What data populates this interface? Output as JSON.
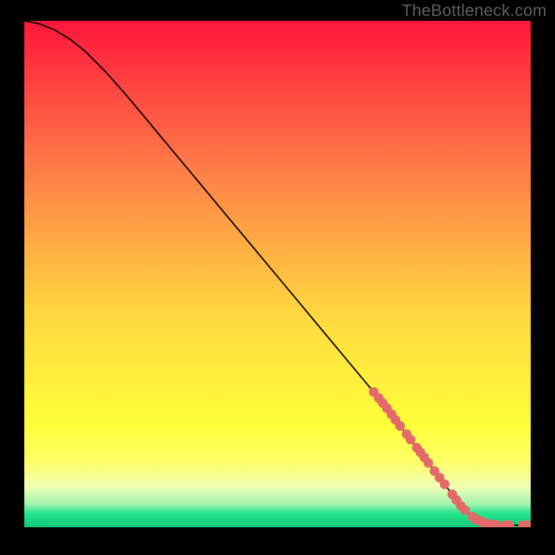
{
  "watermark": "TheBottleneck.com",
  "colors": {
    "frame": "#000000",
    "watermark": "#5f5f5f",
    "curve": "#000000",
    "marker": "#e46a6a",
    "gradient_top": "#ff163b",
    "gradient_mid1": "#ff7948",
    "gradient_mid2": "#ffd83f",
    "gradient_band_top": "#ffff67",
    "gradient_band_bot": "#f1ffb3",
    "gradient_green": "#27e58e",
    "gradient_bottom": "#0fc877"
  },
  "chart_data": {
    "type": "line",
    "title": "",
    "xlabel": "",
    "ylabel": "",
    "xlim": [
      0,
      100
    ],
    "ylim": [
      0,
      100
    ],
    "series": [
      {
        "name": "bottleneck-curve",
        "x": [
          0,
          3,
          6,
          9,
          12,
          16,
          20,
          25,
          30,
          35,
          40,
          45,
          50,
          55,
          60,
          65,
          70,
          75,
          80,
          83,
          85,
          87,
          88.5,
          90,
          92,
          95,
          100
        ],
        "y": [
          100,
          99.4,
          98.2,
          96.4,
          94,
          90,
          85.5,
          79.5,
          73.5,
          67.5,
          61.5,
          55.5,
          49.5,
          43.5,
          37.5,
          31.5,
          25.5,
          19,
          12.5,
          8.5,
          5.8,
          3.4,
          2.1,
          1.2,
          0.6,
          0.4,
          0.4
        ]
      }
    ],
    "markers": {
      "name": "highlighted-points",
      "points": [
        {
          "x": 69.0,
          "y": 26.7
        },
        {
          "x": 70.0,
          "y": 25.5
        },
        {
          "x": 70.8,
          "y": 24.5
        },
        {
          "x": 71.6,
          "y": 23.5
        },
        {
          "x": 72.5,
          "y": 22.3
        },
        {
          "x": 73.3,
          "y": 21.2
        },
        {
          "x": 74.2,
          "y": 20.0
        },
        {
          "x": 75.5,
          "y": 18.4
        },
        {
          "x": 76.3,
          "y": 17.3
        },
        {
          "x": 77.5,
          "y": 15.7
        },
        {
          "x": 78.2,
          "y": 14.8
        },
        {
          "x": 79.0,
          "y": 13.8
        },
        {
          "x": 79.8,
          "y": 12.7
        },
        {
          "x": 81.0,
          "y": 11.1
        },
        {
          "x": 82.0,
          "y": 9.8
        },
        {
          "x": 83.0,
          "y": 8.5
        },
        {
          "x": 84.5,
          "y": 6.5
        },
        {
          "x": 85.3,
          "y": 5.4
        },
        {
          "x": 86.2,
          "y": 4.2
        },
        {
          "x": 87.0,
          "y": 3.4
        },
        {
          "x": 88.5,
          "y": 2.1
        },
        {
          "x": 89.1,
          "y": 1.6
        },
        {
          "x": 89.8,
          "y": 1.3
        },
        {
          "x": 90.5,
          "y": 1.0
        },
        {
          "x": 91.3,
          "y": 0.7
        },
        {
          "x": 92.0,
          "y": 0.6
        },
        {
          "x": 93.2,
          "y": 0.5
        },
        {
          "x": 95.0,
          "y": 0.4
        },
        {
          "x": 95.8,
          "y": 0.4
        },
        {
          "x": 98.5,
          "y": 0.4
        },
        {
          "x": 99.3,
          "y": 0.4
        }
      ]
    }
  }
}
